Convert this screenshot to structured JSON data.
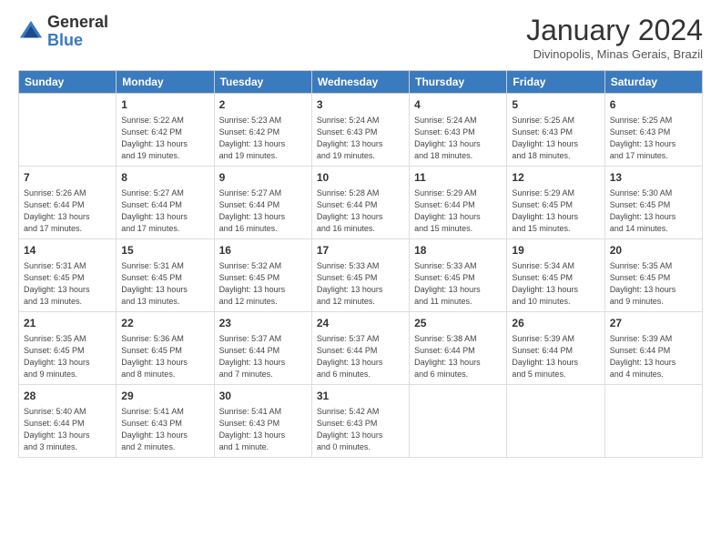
{
  "logo": {
    "general": "General",
    "blue": "Blue"
  },
  "title": "January 2024",
  "subtitle": "Divinopolis, Minas Gerais, Brazil",
  "days_of_week": [
    "Sunday",
    "Monday",
    "Tuesday",
    "Wednesday",
    "Thursday",
    "Friday",
    "Saturday"
  ],
  "weeks": [
    [
      {
        "num": "",
        "info": ""
      },
      {
        "num": "1",
        "info": "Sunrise: 5:22 AM\nSunset: 6:42 PM\nDaylight: 13 hours\nand 19 minutes."
      },
      {
        "num": "2",
        "info": "Sunrise: 5:23 AM\nSunset: 6:42 PM\nDaylight: 13 hours\nand 19 minutes."
      },
      {
        "num": "3",
        "info": "Sunrise: 5:24 AM\nSunset: 6:43 PM\nDaylight: 13 hours\nand 19 minutes."
      },
      {
        "num": "4",
        "info": "Sunrise: 5:24 AM\nSunset: 6:43 PM\nDaylight: 13 hours\nand 18 minutes."
      },
      {
        "num": "5",
        "info": "Sunrise: 5:25 AM\nSunset: 6:43 PM\nDaylight: 13 hours\nand 18 minutes."
      },
      {
        "num": "6",
        "info": "Sunrise: 5:25 AM\nSunset: 6:43 PM\nDaylight: 13 hours\nand 17 minutes."
      }
    ],
    [
      {
        "num": "7",
        "info": "Sunrise: 5:26 AM\nSunset: 6:44 PM\nDaylight: 13 hours\nand 17 minutes."
      },
      {
        "num": "8",
        "info": "Sunrise: 5:27 AM\nSunset: 6:44 PM\nDaylight: 13 hours\nand 17 minutes."
      },
      {
        "num": "9",
        "info": "Sunrise: 5:27 AM\nSunset: 6:44 PM\nDaylight: 13 hours\nand 16 minutes."
      },
      {
        "num": "10",
        "info": "Sunrise: 5:28 AM\nSunset: 6:44 PM\nDaylight: 13 hours\nand 16 minutes."
      },
      {
        "num": "11",
        "info": "Sunrise: 5:29 AM\nSunset: 6:44 PM\nDaylight: 13 hours\nand 15 minutes."
      },
      {
        "num": "12",
        "info": "Sunrise: 5:29 AM\nSunset: 6:45 PM\nDaylight: 13 hours\nand 15 minutes."
      },
      {
        "num": "13",
        "info": "Sunrise: 5:30 AM\nSunset: 6:45 PM\nDaylight: 13 hours\nand 14 minutes."
      }
    ],
    [
      {
        "num": "14",
        "info": "Sunrise: 5:31 AM\nSunset: 6:45 PM\nDaylight: 13 hours\nand 13 minutes."
      },
      {
        "num": "15",
        "info": "Sunrise: 5:31 AM\nSunset: 6:45 PM\nDaylight: 13 hours\nand 13 minutes."
      },
      {
        "num": "16",
        "info": "Sunrise: 5:32 AM\nSunset: 6:45 PM\nDaylight: 13 hours\nand 12 minutes."
      },
      {
        "num": "17",
        "info": "Sunrise: 5:33 AM\nSunset: 6:45 PM\nDaylight: 13 hours\nand 12 minutes."
      },
      {
        "num": "18",
        "info": "Sunrise: 5:33 AM\nSunset: 6:45 PM\nDaylight: 13 hours\nand 11 minutes."
      },
      {
        "num": "19",
        "info": "Sunrise: 5:34 AM\nSunset: 6:45 PM\nDaylight: 13 hours\nand 10 minutes."
      },
      {
        "num": "20",
        "info": "Sunrise: 5:35 AM\nSunset: 6:45 PM\nDaylight: 13 hours\nand 9 minutes."
      }
    ],
    [
      {
        "num": "21",
        "info": "Sunrise: 5:35 AM\nSunset: 6:45 PM\nDaylight: 13 hours\nand 9 minutes."
      },
      {
        "num": "22",
        "info": "Sunrise: 5:36 AM\nSunset: 6:45 PM\nDaylight: 13 hours\nand 8 minutes."
      },
      {
        "num": "23",
        "info": "Sunrise: 5:37 AM\nSunset: 6:44 PM\nDaylight: 13 hours\nand 7 minutes."
      },
      {
        "num": "24",
        "info": "Sunrise: 5:37 AM\nSunset: 6:44 PM\nDaylight: 13 hours\nand 6 minutes."
      },
      {
        "num": "25",
        "info": "Sunrise: 5:38 AM\nSunset: 6:44 PM\nDaylight: 13 hours\nand 6 minutes."
      },
      {
        "num": "26",
        "info": "Sunrise: 5:39 AM\nSunset: 6:44 PM\nDaylight: 13 hours\nand 5 minutes."
      },
      {
        "num": "27",
        "info": "Sunrise: 5:39 AM\nSunset: 6:44 PM\nDaylight: 13 hours\nand 4 minutes."
      }
    ],
    [
      {
        "num": "28",
        "info": "Sunrise: 5:40 AM\nSunset: 6:44 PM\nDaylight: 13 hours\nand 3 minutes."
      },
      {
        "num": "29",
        "info": "Sunrise: 5:41 AM\nSunset: 6:43 PM\nDaylight: 13 hours\nand 2 minutes."
      },
      {
        "num": "30",
        "info": "Sunrise: 5:41 AM\nSunset: 6:43 PM\nDaylight: 13 hours\nand 1 minute."
      },
      {
        "num": "31",
        "info": "Sunrise: 5:42 AM\nSunset: 6:43 PM\nDaylight: 13 hours\nand 0 minutes."
      },
      {
        "num": "",
        "info": ""
      },
      {
        "num": "",
        "info": ""
      },
      {
        "num": "",
        "info": ""
      }
    ]
  ]
}
